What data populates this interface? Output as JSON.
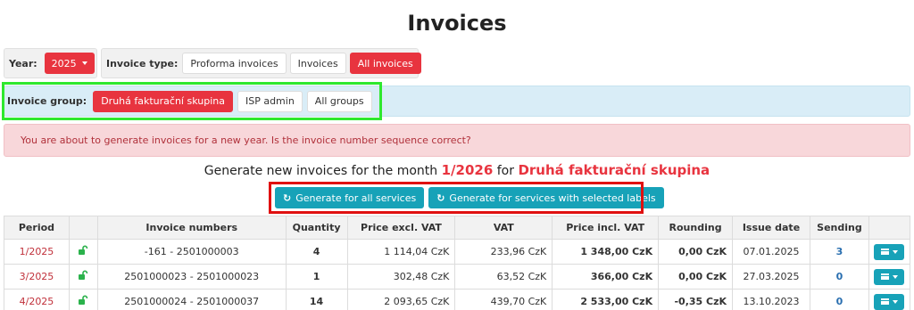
{
  "page_title": "Invoices",
  "year": {
    "label": "Year:",
    "value": "2025"
  },
  "invoice_type": {
    "label": "Invoice type:",
    "options": [
      "Proforma invoices",
      "Invoices",
      "All invoices"
    ],
    "selected": "All invoices"
  },
  "invoice_group": {
    "label": "Invoice group:",
    "options": [
      "Druhá fakturační skupina",
      "ISP admin",
      "All groups"
    ],
    "selected": "Druhá fakturační skupina"
  },
  "alert_text": "You are about to generate invoices for a new year. Is the invoice number sequence correct?",
  "generate": {
    "prefix": "Generate new invoices for the month",
    "month": "1/2026",
    "for": "for",
    "group": "Druhá fakturační skupina",
    "all_label": "Generate for all services",
    "labels_label": "Generate for services with selected labels"
  },
  "table": {
    "headers": [
      "Period",
      "",
      "Invoice numbers",
      "Quantity",
      "Price excl. VAT",
      "VAT",
      "Price incl. VAT",
      "Rounding",
      "Issue date",
      "Sending",
      ""
    ],
    "rows": [
      {
        "period": "1/2025",
        "numbers": "-161 - 2501000003",
        "quantity": "4",
        "price_excl": "1 114,04 CzK",
        "vat": "233,96 CzK",
        "price_incl": "1 348,00 CzK",
        "rounding": "0,00 CzK",
        "issue_date": "07.01.2025",
        "sending": "3"
      },
      {
        "period": "3/2025",
        "numbers": "2501000023 - 2501000023",
        "quantity": "1",
        "price_excl": "302,48 CzK",
        "vat": "63,52 CzK",
        "price_incl": "366,00 CzK",
        "rounding": "0,00 CzK",
        "issue_date": "27.03.2025",
        "sending": "0"
      },
      {
        "period": "4/2025",
        "numbers": "2501000024 - 2501000037",
        "quantity": "14",
        "price_excl": "2 093,65 CzK",
        "vat": "439,70 CzK",
        "price_incl": "2 533,00 CzK",
        "rounding": "-0,35 CzK",
        "issue_date": "13.10.2023",
        "sending": "0"
      }
    ]
  },
  "colors": {
    "accent_red": "#e8343f",
    "teal": "#17a2b8",
    "lock_green": "#2bb24c"
  }
}
